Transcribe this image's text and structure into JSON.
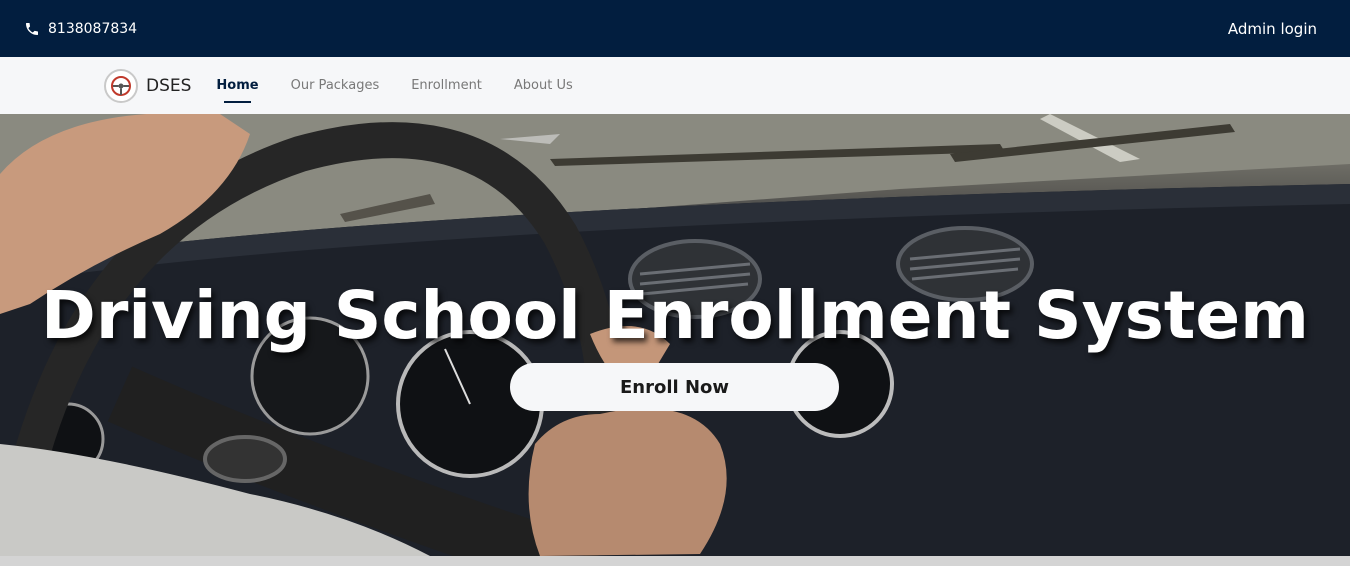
{
  "topbar": {
    "phone": "8138087834",
    "admin_login": "Admin login"
  },
  "navbar": {
    "brand": "DSES",
    "links": [
      {
        "label": "Home",
        "active": true
      },
      {
        "label": "Our Packages",
        "active": false
      },
      {
        "label": "Enrollment",
        "active": false
      },
      {
        "label": "About Us",
        "active": false
      }
    ]
  },
  "hero": {
    "title": "Driving School Enrollment System",
    "cta": "Enroll Now"
  },
  "colors": {
    "topbar_bg": "#021e3f",
    "navbar_bg": "#f6f7f9",
    "active_link": "#021e3f"
  },
  "icons": {
    "phone": "phone-icon",
    "logo": "steering-wheel-logo-icon"
  }
}
